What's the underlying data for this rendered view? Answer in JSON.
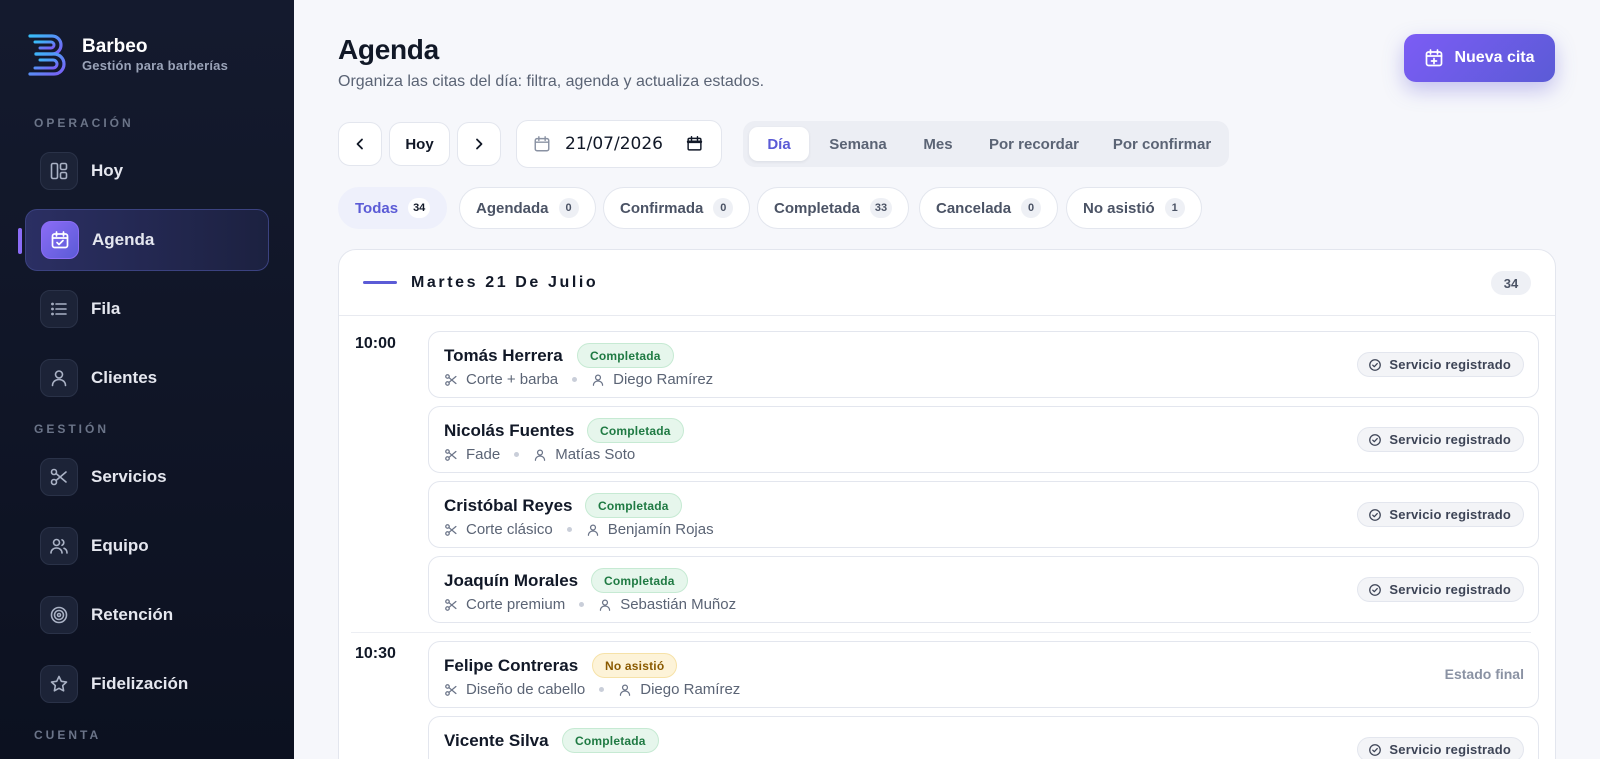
{
  "brand": {
    "name": "Barbeo",
    "subtitle": "Gestión para barberías"
  },
  "sidebar": {
    "sections": [
      {
        "label": "OPERACIÓN"
      },
      {
        "label": "GESTIÓN"
      },
      {
        "label": "CUENTA"
      }
    ],
    "items": [
      {
        "label": "Hoy",
        "icon": "dashboard-icon"
      },
      {
        "label": "Agenda",
        "icon": "calendar-check-icon",
        "active": true
      },
      {
        "label": "Fila",
        "icon": "list-icon"
      },
      {
        "label": "Clientes",
        "icon": "user-icon"
      },
      {
        "label": "Servicios",
        "icon": "scissors-icon"
      },
      {
        "label": "Equipo",
        "icon": "team-icon"
      },
      {
        "label": "Retención",
        "icon": "target-icon"
      },
      {
        "label": "Fidelización",
        "icon": "star-icon"
      }
    ]
  },
  "header": {
    "title": "Agenda",
    "subtitle": "Organiza las citas del día: filtra, agenda y actualiza estados.",
    "new_button": "Nueva cita"
  },
  "controls": {
    "today_label": "Hoy",
    "date_value": "21/07/2026",
    "views": [
      "Día",
      "Semana",
      "Mes",
      "Por recordar",
      "Por confirmar"
    ],
    "active_view": "Día"
  },
  "filters": [
    {
      "label": "Todas",
      "count": "34",
      "active": true
    },
    {
      "label": "Agendada",
      "count": "0"
    },
    {
      "label": "Confirmada",
      "count": "0"
    },
    {
      "label": "Completada",
      "count": "33"
    },
    {
      "label": "Cancelada",
      "count": "0"
    },
    {
      "label": "No asistió",
      "count": "1"
    }
  ],
  "day": {
    "title": "Martes 21 De Julio",
    "count": "34",
    "slots": [
      {
        "time": "10:00",
        "appointments": [
          {
            "client": "Tomás Herrera",
            "status": "Completada",
            "service": "Corte + barba",
            "barber": "Diego Ramírez",
            "action": "Servicio registrado"
          },
          {
            "client": "Nicolás Fuentes",
            "status": "Completada",
            "service": "Fade",
            "barber": "Matías Soto",
            "action": "Servicio registrado"
          },
          {
            "client": "Cristóbal Reyes",
            "status": "Completada",
            "service": "Corte clásico",
            "barber": "Benjamín Rojas",
            "action": "Servicio registrado"
          },
          {
            "client": "Joaquín Morales",
            "status": "Completada",
            "service": "Corte premium",
            "barber": "Sebastián Muñoz",
            "action": "Servicio registrado"
          }
        ]
      },
      {
        "time": "10:30",
        "appointments": [
          {
            "client": "Felipe Contreras",
            "status": "No asistió",
            "service": "Diseño de cabello",
            "barber": "Diego Ramírez",
            "action": "Estado final"
          },
          {
            "client": "Vicente Silva",
            "status": "Completada",
            "action": "Servicio registrado"
          }
        ]
      }
    ]
  }
}
